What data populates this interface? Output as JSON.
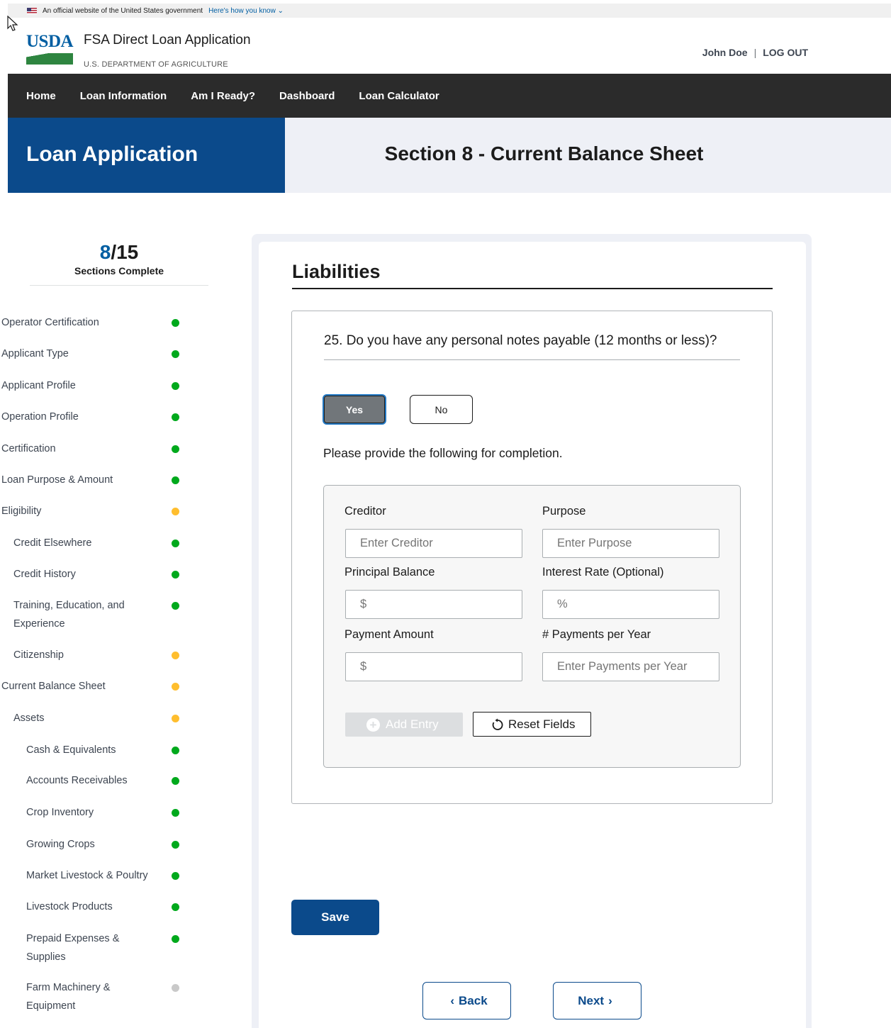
{
  "gov_banner": {
    "text": "An official website of the United States government",
    "link": "Here's how you know"
  },
  "header": {
    "logo_text": "USDA",
    "app_title": "FSA Direct Loan Application",
    "department": "U.S. DEPARTMENT OF AGRICULTURE",
    "user_name": "John Doe",
    "separator": "|",
    "logout": "LOG OUT"
  },
  "nav": {
    "items": [
      "Home",
      "Loan Information",
      "Am I Ready?",
      "Dashboard",
      "Loan Calculator"
    ]
  },
  "page": {
    "title": "Loan Application",
    "section_title": "Section 8 - Current Balance Sheet"
  },
  "progress": {
    "current": "8",
    "total": "/15",
    "label": "Sections Complete"
  },
  "sidebar": {
    "items": [
      {
        "label": "Operator Certification",
        "status": "complete"
      },
      {
        "label": "Applicant Type",
        "status": "complete"
      },
      {
        "label": "Applicant Profile",
        "status": "complete"
      },
      {
        "label": "Operation Profile",
        "status": "complete"
      },
      {
        "label": "Certification",
        "status": "complete"
      },
      {
        "label": "Loan Purpose & Amount",
        "status": "complete"
      },
      {
        "label": "Eligibility",
        "status": "in-progress"
      },
      {
        "label": "Credit Elsewhere",
        "status": "complete"
      },
      {
        "label": "Credit History",
        "status": "complete"
      },
      {
        "label": "Training, Education, and",
        "label2": "Experience",
        "status": "complete"
      },
      {
        "label": "Citizenship",
        "status": "in-progress"
      },
      {
        "label": "Current Balance Sheet",
        "status": "in-progress"
      },
      {
        "label": "Assets",
        "status": "in-progress"
      },
      {
        "label": "Cash & Equivalents",
        "status": "complete"
      },
      {
        "label": "Accounts Receivables",
        "status": "complete"
      },
      {
        "label": "Crop Inventory",
        "status": "complete"
      },
      {
        "label": "Growing Crops",
        "status": "complete"
      },
      {
        "label": "Market Livestock & Poultry",
        "status": "complete"
      },
      {
        "label": "Livestock Products",
        "status": "complete"
      },
      {
        "label": "Prepaid Expenses &",
        "label2": "Supplies",
        "status": "complete"
      },
      {
        "label": "Farm Machinery &",
        "label2": "Equipment",
        "status": "not-started"
      }
    ]
  },
  "main": {
    "heading": "Liabilities",
    "question": "25. Do you have any personal notes payable (12 months or less)?",
    "yes_label": "Yes",
    "no_label": "No",
    "selected": "Yes",
    "instructions": "Please provide the following for completion.",
    "form": {
      "creditor_label": "Creditor",
      "creditor_placeholder": "Enter Creditor",
      "purpose_label": "Purpose",
      "purpose_placeholder": "Enter Purpose",
      "principal_label": "Principal Balance",
      "principal_placeholder": "$",
      "interest_label": "Interest Rate (Optional)",
      "interest_placeholder": "%",
      "payment_label": "Payment Amount",
      "payment_placeholder": "$",
      "payments_per_year_label": "# Payments per Year",
      "payments_per_year_placeholder": "Enter Payments per Year"
    },
    "add_entry_label": "Add Entry",
    "reset_label": "Reset Fields",
    "save_label": "Save",
    "back_label": "Back",
    "next_label": "Next"
  },
  "colors": {
    "primary": "#0b4a8b",
    "nav_bg": "#2b2b2b",
    "complete": "#00a91c",
    "in_progress": "#ffbe2e",
    "not_started": "#c9c9c9"
  }
}
